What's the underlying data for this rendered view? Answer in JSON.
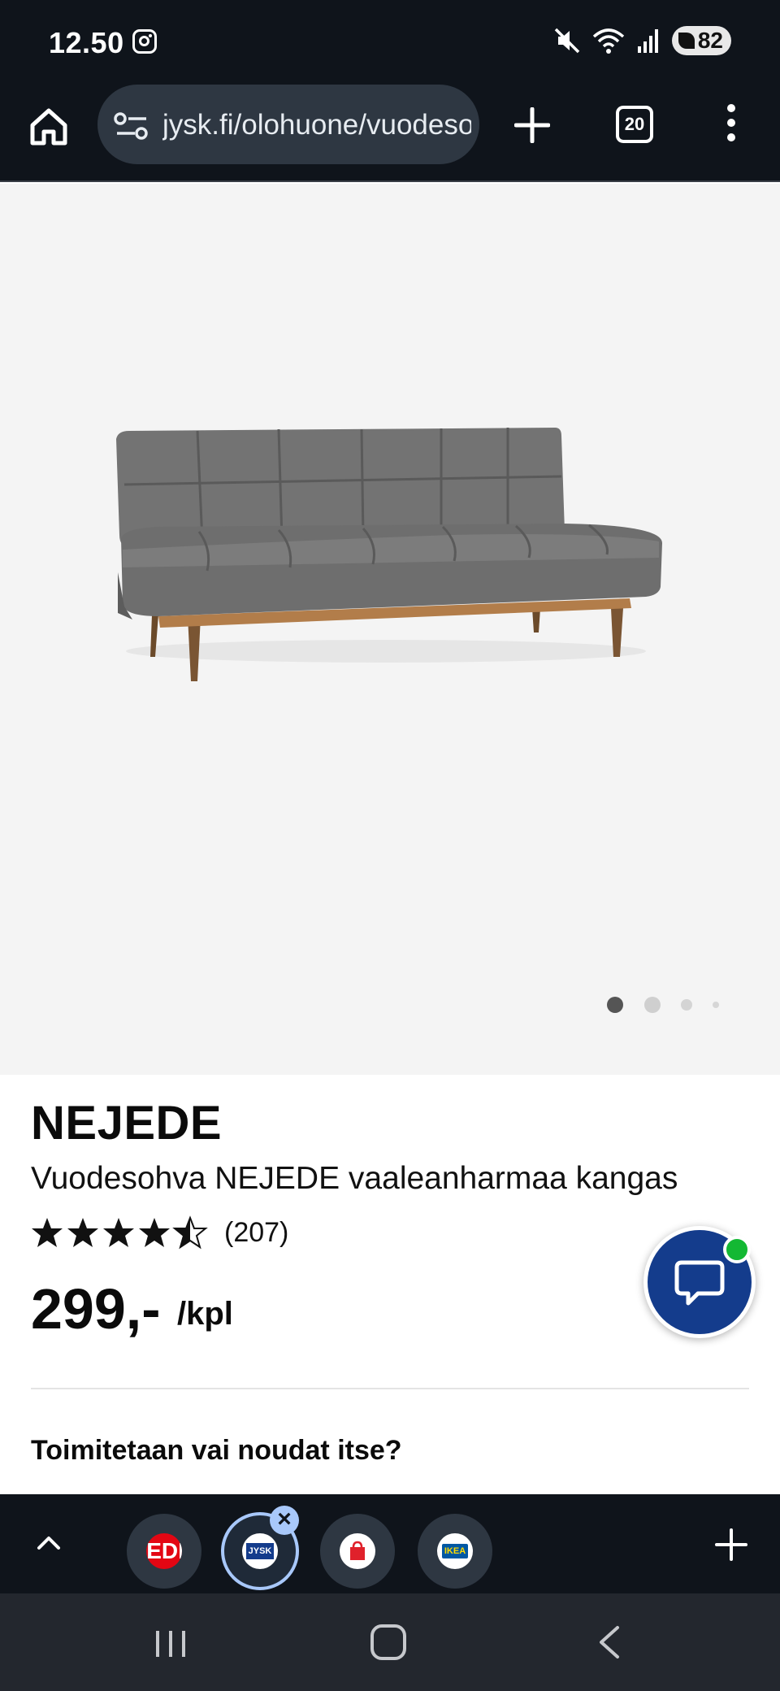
{
  "status_bar": {
    "time": "12.50",
    "battery": "82"
  },
  "browser": {
    "url": "jysk.fi/olohuone/vuodesohvat",
    "tab_count": "20"
  },
  "gallery": {
    "image_count": 4,
    "active_index": 0
  },
  "product": {
    "name": "NEJEDE",
    "description": "Vuodesohva NEJEDE vaaleanharmaa kangas",
    "rating_stars": 4.5,
    "rating_count": "(207)",
    "price": "299,-",
    "price_unit": "/kpl",
    "delivery_question": "Toimitetaan vai noudat itse?"
  },
  "tab_strip": {
    "tabs": [
      {
        "icon": "mediamarkt-icon",
        "label": "MEDIA",
        "active": false
      },
      {
        "icon": "jysk-icon",
        "label": "JYSK",
        "active": true
      },
      {
        "icon": "shopping-bag-icon",
        "label": "",
        "active": false
      },
      {
        "icon": "ikea-icon",
        "label": "IKEA",
        "active": false
      }
    ]
  },
  "colors": {
    "chrome_bg": "#0f141b",
    "url_pill": "#2e3742",
    "chat_button": "#143c8c",
    "chat_badge": "#13b833",
    "active_tab_ring": "#a8c8fa"
  }
}
